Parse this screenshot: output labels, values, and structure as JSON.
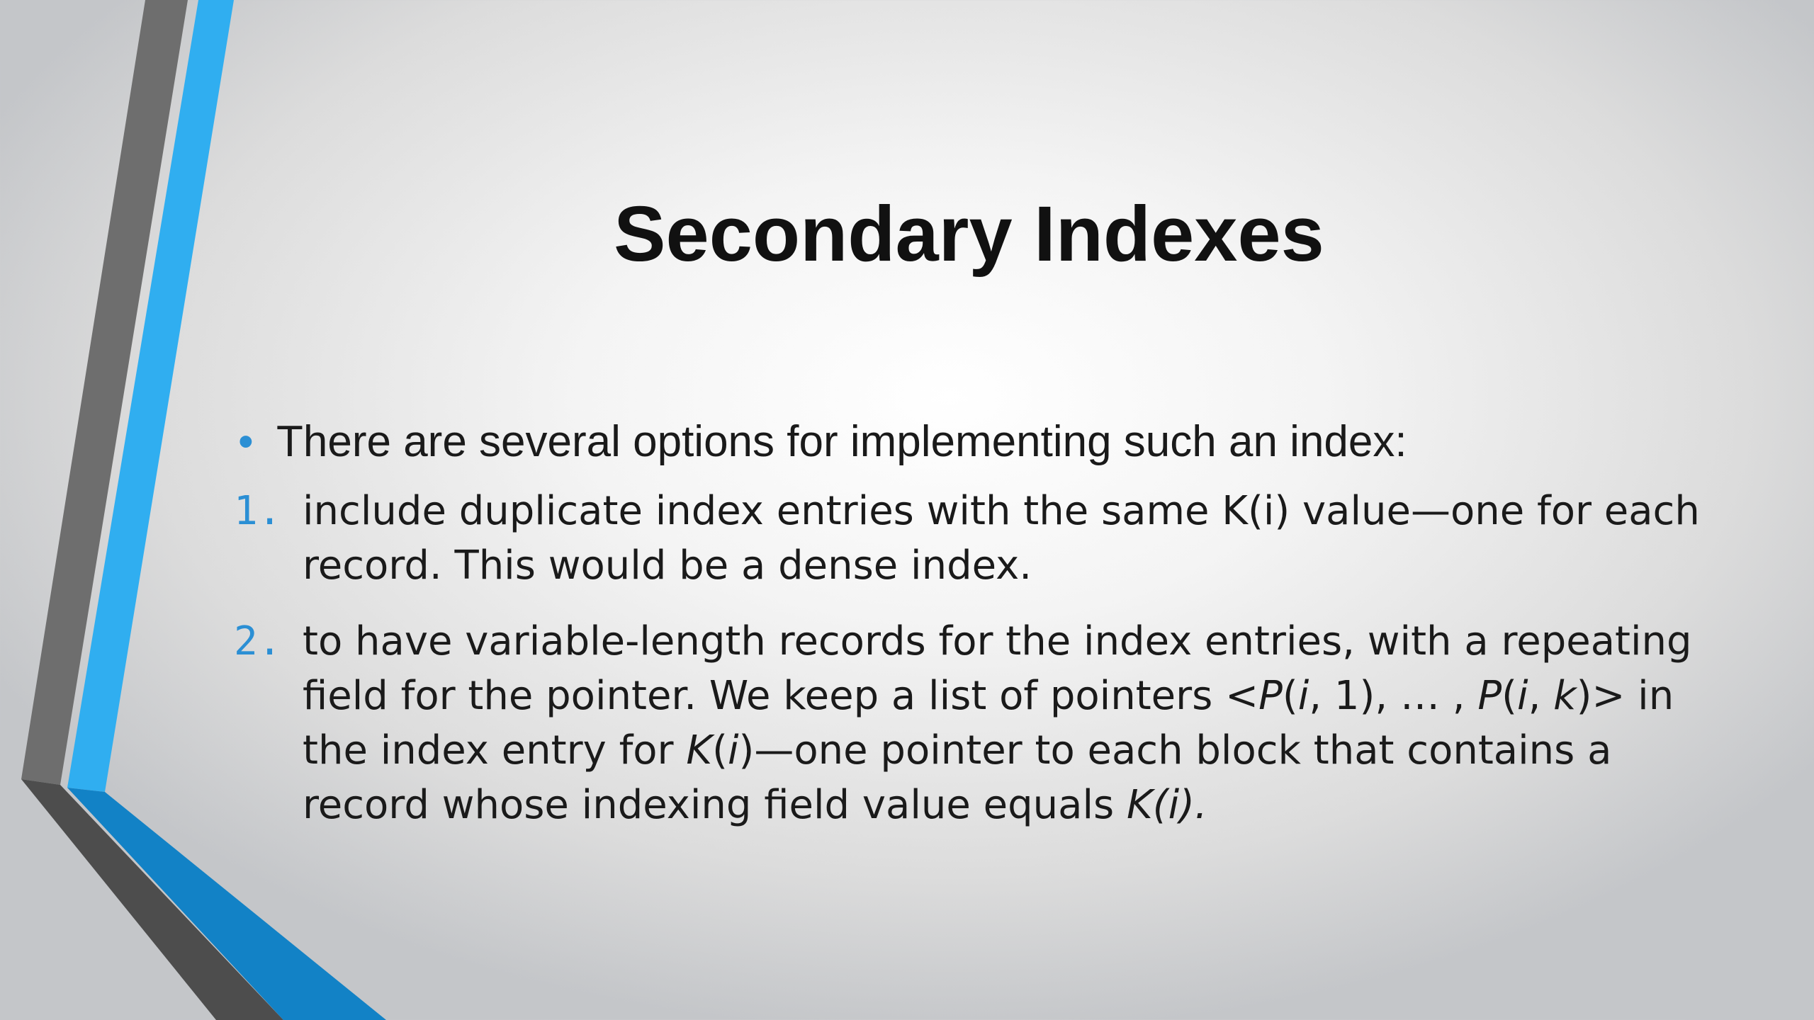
{
  "slide": {
    "title": "Secondary Indexes",
    "bullet": "There are several options for implementing such an index:",
    "items": [
      {
        "number": "1.",
        "text": "include duplicate index entries with the same K(i) value—one for each record. This would be a dense index."
      },
      {
        "number": "2.",
        "text_parts": [
          {
            "text": "to have variable-length records for the index entries, with a repeating field for the pointer. We keep a list of pointers <"
          },
          {
            "text": "P",
            "italic": true
          },
          {
            "text": "("
          },
          {
            "text": "i",
            "italic": true
          },
          {
            "text": ", 1), … , "
          },
          {
            "text": "P",
            "italic": true
          },
          {
            "text": "("
          },
          {
            "text": "i",
            "italic": true
          },
          {
            "text": ", "
          },
          {
            "text": "k",
            "italic": true
          },
          {
            "text": ")> in the index entry for "
          },
          {
            "text": "K",
            "italic": true
          },
          {
            "text": "("
          },
          {
            "text": "i",
            "italic": true
          },
          {
            "text": ")—one pointer to each block that contains a record whose indexing field value equals "
          },
          {
            "text": "K(i).",
            "italic": true
          }
        ]
      }
    ]
  },
  "colors": {
    "accent_blue": "#2b8fd4",
    "stripe_light_blue": "#30aef0",
    "stripe_dark_blue": "#1282c6",
    "stripe_gray": "#6e6e6e",
    "stripe_dark_gray": "#4d4d4d",
    "text": "#1a1a1a"
  }
}
